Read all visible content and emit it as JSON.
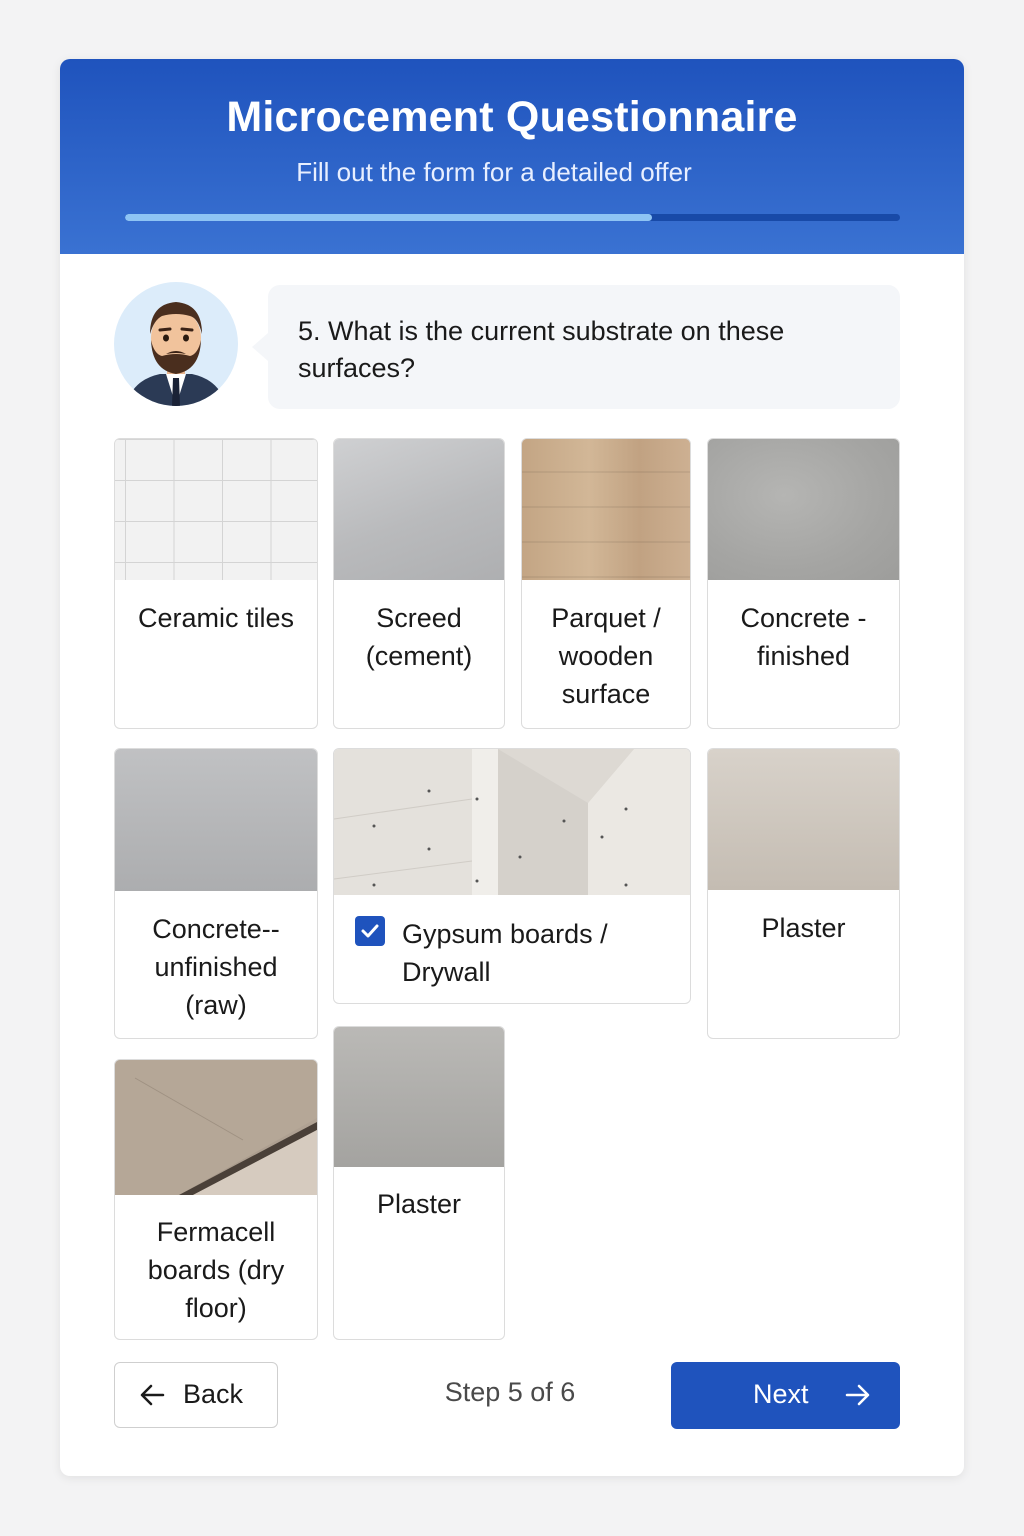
{
  "header": {
    "title": "Microcement Questionnaire",
    "subtitle": "Fill out the form for a detailed offer",
    "progress": 0.68
  },
  "question": {
    "avatar_icon": "bearded-man-avatar",
    "text": "5. What is the current substrate on these surfaces?"
  },
  "options": [
    {
      "label": "Ceramic tiles",
      "selected": false
    },
    {
      "label": "Screed (cement)",
      "selected": false
    },
    {
      "label": "Parquet / wooden surface",
      "selected": false
    },
    {
      "label": "Concrete - finished",
      "selected": false
    },
    {
      "label": "Concrete-- unfinished (raw)",
      "selected": false
    },
    {
      "label": "Gypsum boards / Drywall",
      "selected": true
    },
    {
      "label": "Plaster",
      "selected": false
    },
    {
      "label": "Fermacell boards (dry floor)",
      "selected": false
    },
    {
      "label": "Plaster",
      "selected": false
    }
  ],
  "footer": {
    "back_label": "Back",
    "step_text": "Step 5 of 6",
    "next_label": "Next"
  },
  "colors": {
    "primary": "#1f53bd",
    "progress_fill": "#8ec4f4",
    "bubble_bg": "#f4f6f9"
  }
}
